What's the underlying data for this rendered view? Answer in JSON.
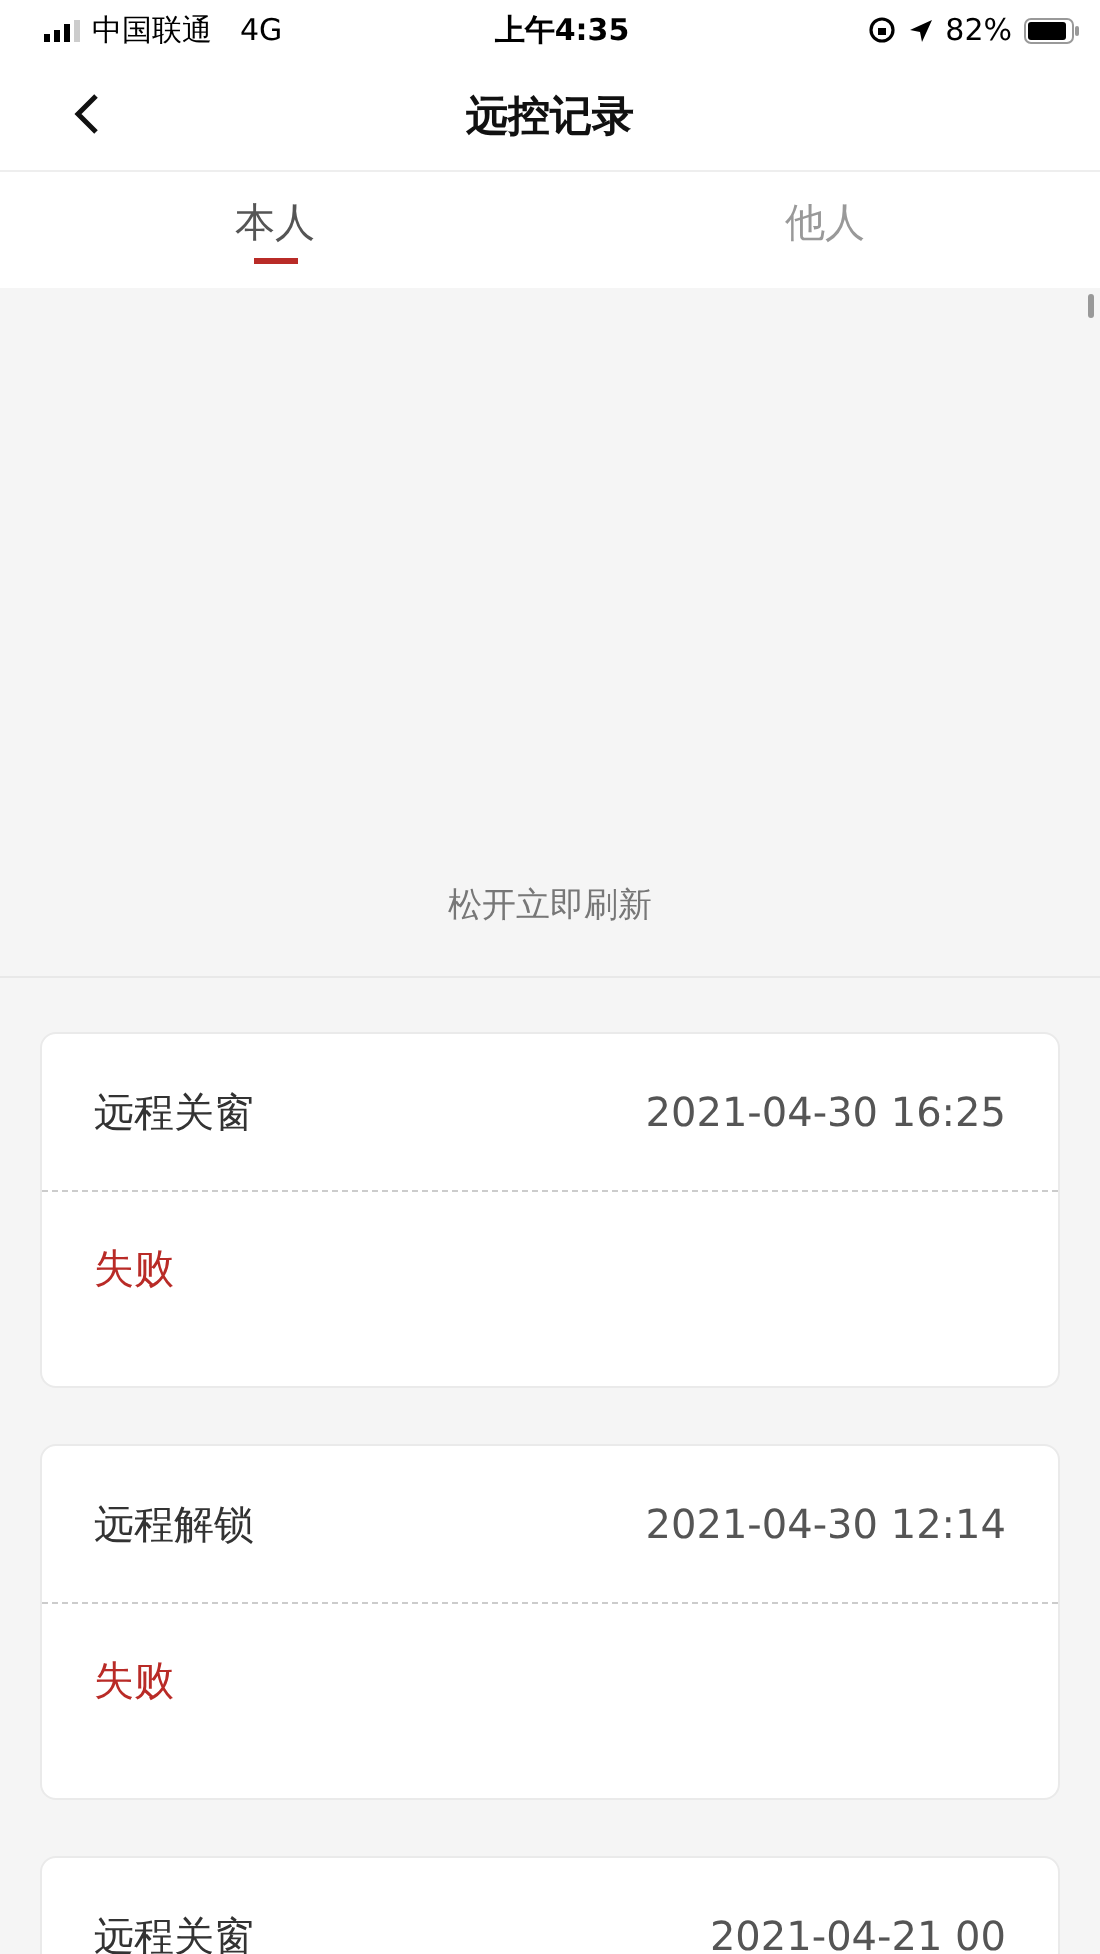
{
  "status_bar": {
    "carrier": "中国联通",
    "network": "4G",
    "time": "上午4:35",
    "battery": "82%"
  },
  "nav": {
    "title": "远控记录"
  },
  "tabs": [
    {
      "label": "本人",
      "selected": true
    },
    {
      "label": "他人",
      "selected": false
    }
  ],
  "refresh_hint": "松开立即刷新",
  "records": [
    {
      "action": "远程关窗",
      "time": "2021-04-30 16:25",
      "result": "失败",
      "kind": "failed"
    },
    {
      "action": "远程解锁",
      "time": "2021-04-30 12:14",
      "result": "失败",
      "kind": "failed"
    },
    {
      "action": "远程关窗",
      "time": "2021-04-21 00",
      "kind": "partial"
    }
  ]
}
